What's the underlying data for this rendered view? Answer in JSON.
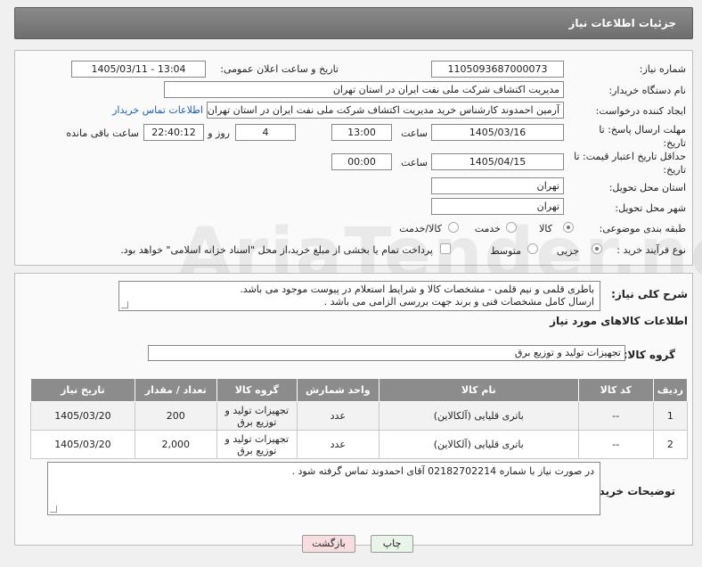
{
  "header": {
    "title": "جزئیات اطلاعات نیاز"
  },
  "form": {
    "need_number_label": "شماره نیاز:",
    "need_number": "1105093687000073",
    "announce_label": "تاریخ و ساعت اعلان عمومی:",
    "announce_value": "1405/03/11 - 13:04",
    "buyer_org_label": "نام دستگاه خریدار:",
    "buyer_org": "مدیریت اکتشاف شرکت ملی نفت ایران در استان تهران",
    "creator_label": "ایجاد کننده درخواست:",
    "creator": "آرمین احمدوند کارشناس خرید مدیریت اکتشاف شرکت ملی نفت ایران در استان تهران",
    "buyer_contact_link": "اطلاعات تماس خریدار",
    "reply_deadline_label": "مهلت ارسال پاسخ: تا تاریخ:",
    "reply_date": "1405/03/16",
    "time_label": "ساعت",
    "reply_time": "13:00",
    "days_value": "4",
    "days_label": "روز و",
    "remaining_time": "22:40:12",
    "remaining_label": "ساعت باقی مانده",
    "price_validity_label": "حداقل تاریخ اعتبار قیمت: تا تاریخ:",
    "price_date": "1405/04/15",
    "price_time_label": "ساعت",
    "price_time": "00:00",
    "delivery_province_label": "استان محل تحویل:",
    "delivery_province": "تهران",
    "delivery_city_label": "شهر محل تحویل:",
    "delivery_city": "تهران",
    "category_label": "طبقه بندی موضوعی:",
    "category_options": [
      "کالا",
      "خدمت",
      "کالا/خدمت"
    ],
    "purchase_type_label": "نوع فرآیند خرید :",
    "purchase_options": [
      "جزیی",
      "متوسط"
    ],
    "payment_note": "پرداخت تمام یا بخشی از مبلغ خرید،از محل \"اسناد خزانه اسلامی\" خواهد بود."
  },
  "description": {
    "label": "شرح کلی نیاز:",
    "text_line1": "باطری قلمی و نیم قلمی - مشخصات کالا و شرایط استعلام در پیوست موجود می باشد.",
    "text_line2": "ارسال کامل مشخصات فنی و برند  جهت بررسی الزامی می باشد ."
  },
  "goods": {
    "section_title": "اطلاعات کالاهای مورد نیاز",
    "group_label": "گروه کالا:",
    "group_value": "تجهیزات تولید و توزیع برق",
    "columns": [
      "ردیف",
      "کد کالا",
      "نام کالا",
      "واحد شمارش",
      "گروه کالا",
      "تعداد / مقدار",
      "تاریخ نیاز"
    ],
    "rows": [
      {
        "row": "1",
        "code": "--",
        "name": "باتری قلیایی (آلکالاین)",
        "unit": "عدد",
        "group": "تجهیزات تولید و توزیع برق",
        "qty": "200",
        "date": "1405/03/20"
      },
      {
        "row": "2",
        "code": "--",
        "name": "باتری قلیایی (آلکالاین)",
        "unit": "عدد",
        "group": "تجهیزات تولید و توزیع برق",
        "qty": "2,000",
        "date": "1405/03/20"
      }
    ]
  },
  "buyer_notes": {
    "label": "توضیحات خریدار:",
    "text": "در صورت نیاز با شماره 02182702214 آقای احمدوند تماس گرفته شود ."
  },
  "buttons": {
    "print": "چاپ",
    "back": "بازگشت"
  },
  "watermark": "AriaTender.neT"
}
